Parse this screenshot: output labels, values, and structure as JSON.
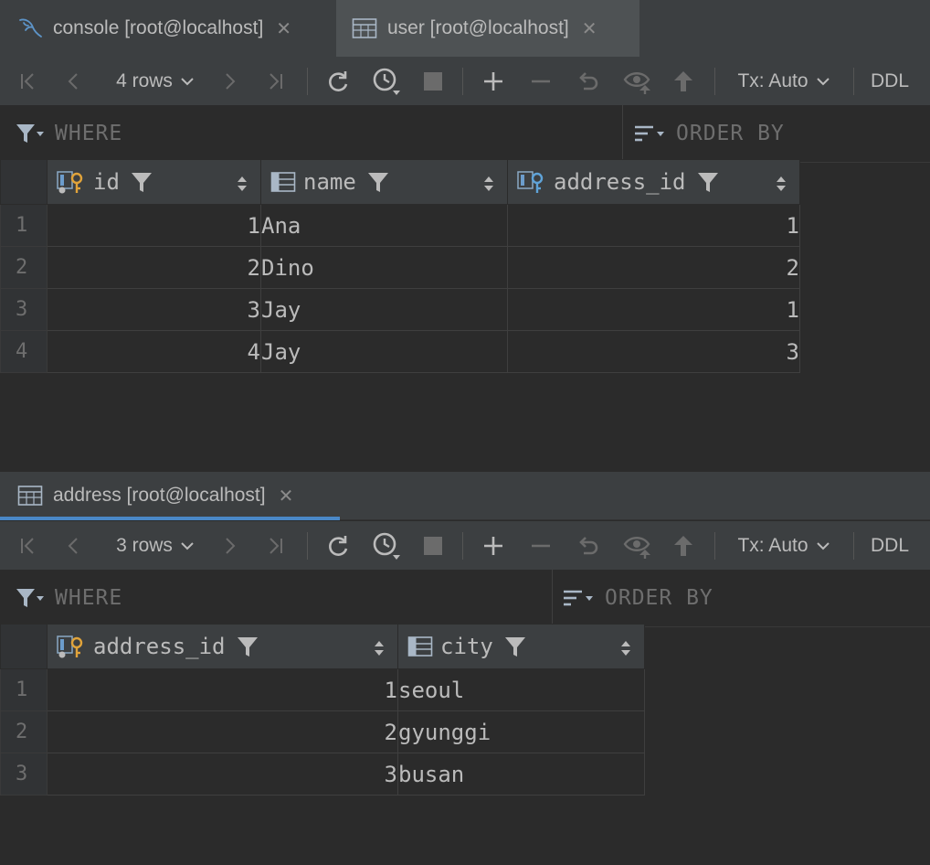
{
  "top_tabs": [
    {
      "label": "console [root@localhost]",
      "icon": "mysql-dolphin-icon",
      "active": false
    },
    {
      "label": "user [root@localhost]",
      "icon": "table-icon",
      "active": true
    }
  ],
  "user_panel": {
    "toolbar": {
      "rows_label": "4 rows",
      "tx_label": "Tx: Auto",
      "ddl_label": "DDL"
    },
    "filter": {
      "where": "WHERE",
      "order_by": "ORDER BY"
    },
    "columns": [
      {
        "name": "id",
        "icon": "primary-key-column-icon"
      },
      {
        "name": "name",
        "icon": "column-icon"
      },
      {
        "name": "address_id",
        "icon": "foreign-key-column-icon"
      }
    ],
    "rows": [
      {
        "n": "1",
        "id": "1",
        "name": "Ana",
        "address_id": "1"
      },
      {
        "n": "2",
        "id": "2",
        "name": "Dino",
        "address_id": "2"
      },
      {
        "n": "3",
        "id": "3",
        "name": "Jay",
        "address_id": "1"
      },
      {
        "n": "4",
        "id": "4",
        "name": "Jay",
        "address_id": "3"
      }
    ]
  },
  "bottom_tab": {
    "label": "address [root@localhost]",
    "icon": "table-icon"
  },
  "address_panel": {
    "toolbar": {
      "rows_label": "3 rows",
      "tx_label": "Tx: Auto",
      "ddl_label": "DDL"
    },
    "filter": {
      "where": "WHERE",
      "order_by": "ORDER BY"
    },
    "columns": [
      {
        "name": "address_id",
        "icon": "primary-key-column-icon"
      },
      {
        "name": "city",
        "icon": "column-icon"
      }
    ],
    "rows": [
      {
        "n": "1",
        "address_id": "1",
        "city": "seoul"
      },
      {
        "n": "2",
        "address_id": "2",
        "city": "gyunggi"
      },
      {
        "n": "3",
        "address_id": "3",
        "city": "busan"
      }
    ]
  },
  "colors": {
    "background": "#2b2b2b",
    "header": "#3c3f41",
    "accent": "#4a88c7",
    "key": "#e0a33a"
  }
}
